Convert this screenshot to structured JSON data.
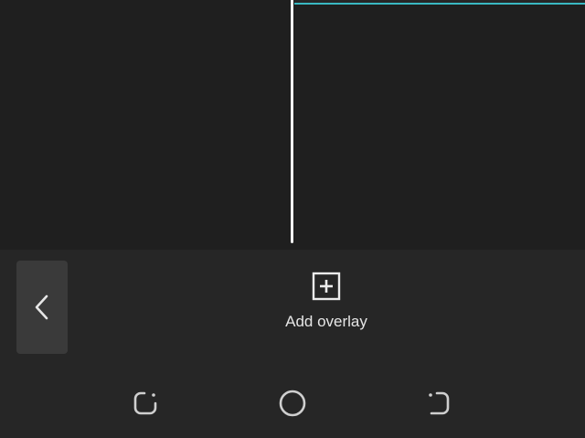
{
  "toolbar": {
    "back_icon": "chevron-left-icon",
    "add_overlay": {
      "icon": "plus-square-icon",
      "label": "Add overlay"
    }
  },
  "navbar": {
    "recent_icon": "recent-apps-icon",
    "home_icon": "home-circle-icon",
    "back_icon": "system-back-icon"
  },
  "colors": {
    "background": "#1e1e1e",
    "toolbar": "#262626",
    "playhead": "#f2f2f2",
    "clip_accent": "#39b8c2",
    "back_button": "#3a3a3a",
    "text": "#e6e6e6"
  }
}
